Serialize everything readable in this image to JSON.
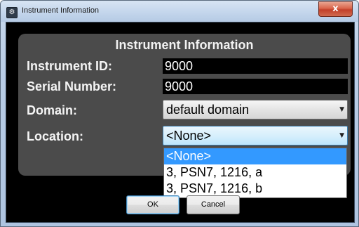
{
  "window": {
    "title": "Instrument Information",
    "app_icon_glyph": "⚙",
    "close_glyph": "x"
  },
  "panel": {
    "title": "Instrument Information"
  },
  "fields": {
    "instrument_id": {
      "label": "Instrument ID:",
      "value": "9000"
    },
    "serial_number": {
      "label": "Serial Number:",
      "value": "9000"
    },
    "domain": {
      "label": "Domain:",
      "value": "default domain"
    },
    "location": {
      "label": "Location:",
      "value": "<None>"
    }
  },
  "location_options": [
    "<None>",
    "3, PSN7, 1216, a",
    "3, PSN7, 1216, b"
  ],
  "location_selected_index": 0,
  "buttons": {
    "ok": "OK",
    "cancel": "Cancel"
  },
  "icons": {
    "app": "gear-icon",
    "close": "close-icon",
    "dropdown_arrow": "chevron-down-icon"
  },
  "colors": {
    "selection": "#3399ff",
    "panel": "#4b4b4b",
    "client_background": "#000000"
  }
}
